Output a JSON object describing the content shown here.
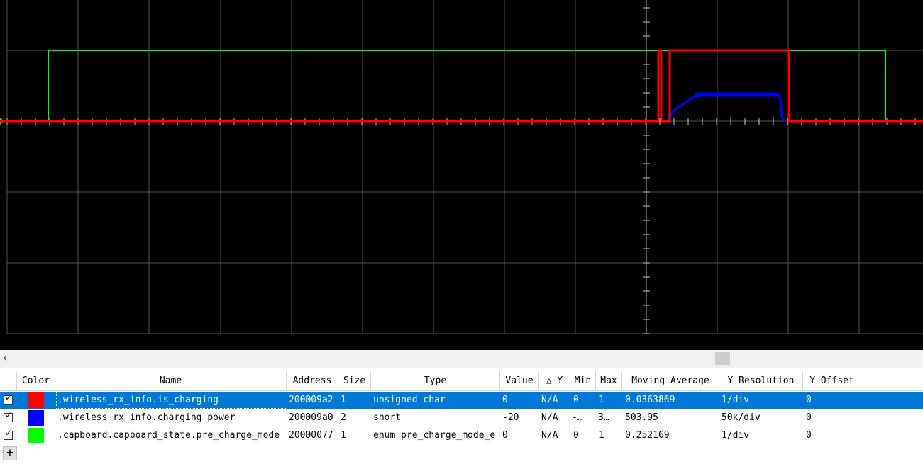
{
  "scope": {
    "background": "#000000",
    "grid_color": "#555555"
  },
  "scroll": {
    "left_arrow": "‹"
  },
  "table": {
    "columns": [
      "Color",
      "Name",
      "Address",
      "Size",
      "Type",
      "Value",
      "△ Y",
      "Min",
      "Max",
      "Moving Average",
      "Y Resolution",
      "Y Offset"
    ],
    "rows": [
      {
        "checked": true,
        "color": "#ff0000",
        "name": ".wireless_rx_info.is_charging",
        "address": "200009a2",
        "size": "1",
        "type": "unsigned char",
        "value": "0",
        "dy": "N/A",
        "min": "0",
        "max": "1",
        "avg": "0.0363869",
        "yres": "1/div",
        "yoff": "0",
        "selected": true
      },
      {
        "checked": true,
        "color": "#0000ff",
        "name": ".wireless_rx_info.charging_power",
        "address": "200009a0",
        "size": "2",
        "type": "short",
        "value": "-20",
        "dy": "N/A",
        "min": "-…",
        "max": "3…",
        "avg": "503.95",
        "yres": "50k/div",
        "yoff": "0",
        "selected": false
      },
      {
        "checked": true,
        "color": "#00ff00",
        "name": ".capboard.capboard_state.pre_charge_mode",
        "address": "20000077",
        "size": "1",
        "type": "enum pre_charge_mode_e",
        "value": "0",
        "dy": "N/A",
        "min": "0",
        "max": "1",
        "avg": "0.252169",
        "yres": "1/div",
        "yoff": "0",
        "selected": false
      }
    ],
    "add_button": "+"
  }
}
